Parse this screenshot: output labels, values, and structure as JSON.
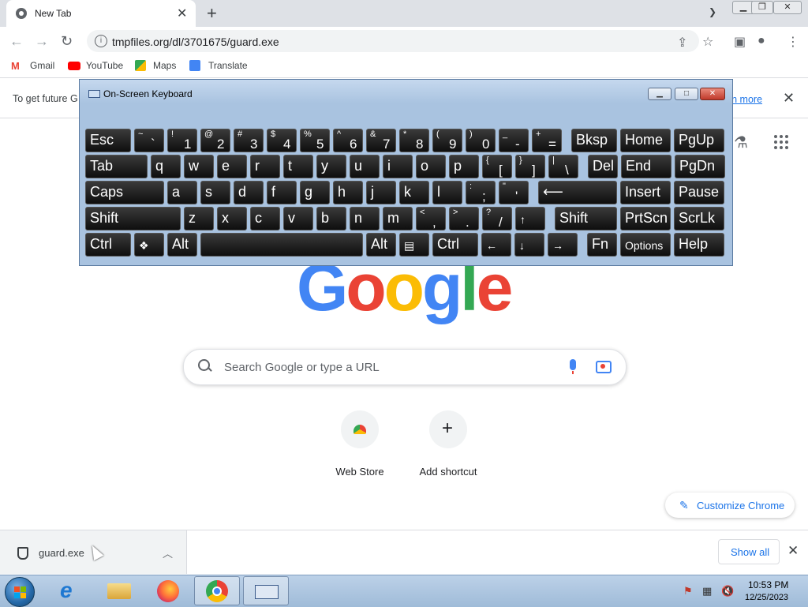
{
  "browser": {
    "tab_title": "New Tab",
    "url": "tmpfiles.org/dl/3701675/guard.exe",
    "bookmarks": [
      "Gmail",
      "YouTube",
      "Maps",
      "Translate"
    ],
    "infobar_text": "To get future G",
    "infobar_link": "arn more"
  },
  "osk": {
    "title": "On-Screen Keyboard",
    "rows": [
      [
        {
          "l": "Esc",
          "w": 58
        },
        {
          "s": "~",
          "b": "`",
          "w": 38
        },
        {
          "s": "!",
          "b": "1",
          "w": 38
        },
        {
          "s": "@",
          "b": "2",
          "w": 38
        },
        {
          "s": "#",
          "b": "3",
          "w": 38
        },
        {
          "s": "$",
          "b": "4",
          "w": 38
        },
        {
          "s": "%",
          "b": "5",
          "w": 38
        },
        {
          "s": "^",
          "b": "6",
          "w": 38
        },
        {
          "s": "&",
          "b": "7",
          "w": 38
        },
        {
          "s": "*",
          "b": "8",
          "w": 38
        },
        {
          "s": "(",
          "b": "9",
          "w": 38
        },
        {
          "s": ")",
          "b": "0",
          "w": 38
        },
        {
          "s": "_",
          "b": "-",
          "w": 38
        },
        {
          "s": "+",
          "b": "=",
          "w": 38
        },
        {
          "l": "Bksp",
          "w": 58,
          "gap": 8
        },
        {
          "l": "Home",
          "w": 64
        },
        {
          "l": "PgUp",
          "w": 64
        }
      ],
      [
        {
          "l": "Tab",
          "w": 79
        },
        {
          "l": "q",
          "w": 38
        },
        {
          "l": "w",
          "w": 38
        },
        {
          "l": "e",
          "w": 38
        },
        {
          "l": "r",
          "w": 38
        },
        {
          "l": "t",
          "w": 38
        },
        {
          "l": "y",
          "w": 38
        },
        {
          "l": "u",
          "w": 38
        },
        {
          "l": "i",
          "w": 38
        },
        {
          "l": "o",
          "w": 38
        },
        {
          "l": "p",
          "w": 38
        },
        {
          "s": "{",
          "b": "[",
          "w": 38
        },
        {
          "s": "}",
          "b": "]",
          "w": 38
        },
        {
          "s": "|",
          "b": "\\",
          "w": 38
        },
        {
          "l": "Del",
          "w": 38,
          "gap": 8
        },
        {
          "l": "End",
          "w": 64
        },
        {
          "l": "PgDn",
          "w": 64
        }
      ],
      [
        {
          "l": "Caps",
          "w": 100
        },
        {
          "l": "a",
          "w": 38
        },
        {
          "l": "s",
          "w": 38
        },
        {
          "l": "d",
          "w": 38
        },
        {
          "l": "f",
          "w": 38
        },
        {
          "l": "g",
          "w": 38
        },
        {
          "l": "h",
          "w": 38
        },
        {
          "l": "j",
          "w": 38
        },
        {
          "l": "k",
          "w": 38
        },
        {
          "l": "l",
          "w": 38
        },
        {
          "s": ":",
          "b": ";",
          "w": 38
        },
        {
          "s": "\"",
          "b": "'",
          "w": 38
        },
        {
          "l": "⟵",
          "w": 100,
          "gap": 8
        },
        {
          "l": "Insert",
          "w": 64
        },
        {
          "l": "Pause",
          "w": 64
        }
      ],
      [
        {
          "l": "Shift",
          "w": 121
        },
        {
          "l": "z",
          "w": 38
        },
        {
          "l": "x",
          "w": 38
        },
        {
          "l": "c",
          "w": 38
        },
        {
          "l": "v",
          "w": 38
        },
        {
          "l": "b",
          "w": 38
        },
        {
          "l": "n",
          "w": 38
        },
        {
          "l": "m",
          "w": 38
        },
        {
          "s": "<",
          "b": ",",
          "w": 38
        },
        {
          "s": ">",
          "b": ".",
          "w": 38
        },
        {
          "s": "?",
          "b": "/",
          "w": 38
        },
        {
          "l": "↑",
          "w": 38,
          "sm": true
        },
        {
          "l": "Shift",
          "w": 79,
          "gap": 8
        },
        {
          "l": "PrtScn",
          "w": 64
        },
        {
          "l": "ScrLk",
          "w": 64
        }
      ],
      [
        {
          "l": "Ctrl",
          "w": 58
        },
        {
          "l": "❖",
          "w": 38,
          "sm": true
        },
        {
          "l": "Alt",
          "w": 38
        },
        {
          "l": "",
          "w": 206
        },
        {
          "l": "Alt",
          "w": 38
        },
        {
          "l": "▤",
          "w": 38,
          "sm": true
        },
        {
          "l": "Ctrl",
          "w": 58
        },
        {
          "l": "←",
          "w": 38,
          "sm": true
        },
        {
          "l": "↓",
          "w": 38,
          "sm": true
        },
        {
          "l": "→",
          "w": 38,
          "sm": true
        },
        {
          "l": "Fn",
          "w": 38,
          "gap": 8
        },
        {
          "l": "Options",
          "w": 64,
          "opt": true
        },
        {
          "l": "Help",
          "w": 64
        }
      ]
    ]
  },
  "page": {
    "logo_letters": [
      "G",
      "o",
      "o",
      "g",
      "l",
      "e"
    ],
    "search_placeholder": "Search Google or type a URL",
    "shortcuts": [
      "Web Store",
      "Add shortcut"
    ],
    "customize_label": "Customize Chrome"
  },
  "downloads": {
    "filename": "guard.exe",
    "show_all": "Show all"
  },
  "taskbar": {
    "time": "10:53 PM",
    "date": "12/25/2023"
  }
}
